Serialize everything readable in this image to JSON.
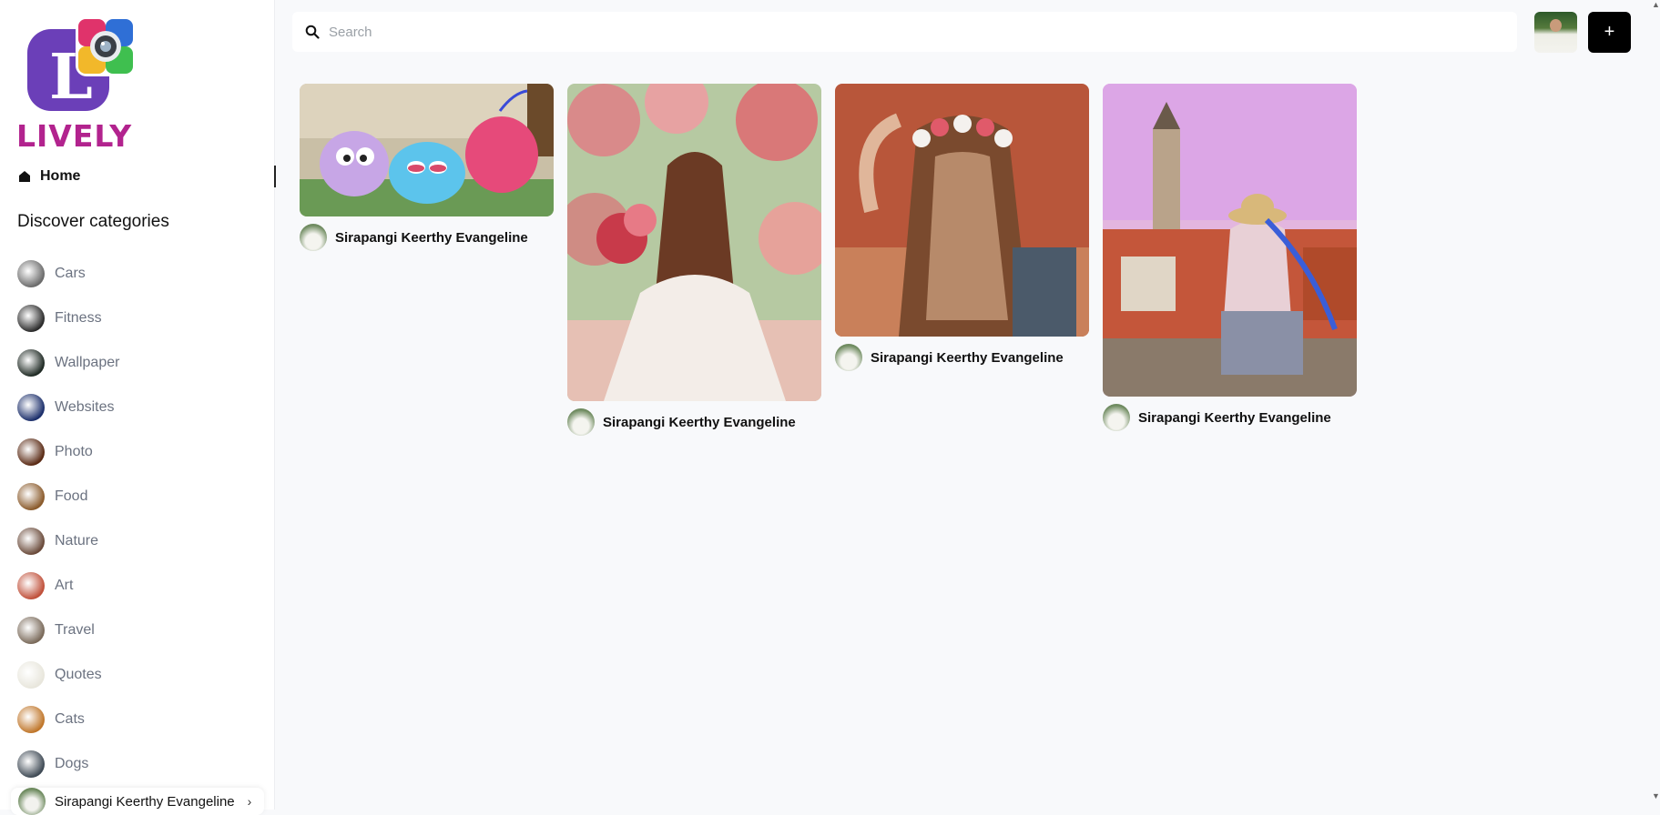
{
  "brand": {
    "name": "LIVELY",
    "initial": "L"
  },
  "nav": {
    "home_label": "Home"
  },
  "sidebar": {
    "discover_title": "Discover categories",
    "categories": [
      {
        "label": "Cars",
        "icon": "cars-thumbnail",
        "color": "#6b6b6b"
      },
      {
        "label": "Fitness",
        "icon": "fitness-thumbnail",
        "color": "#2b2b2b"
      },
      {
        "label": "Wallpaper",
        "icon": "wallpaper-thumbnail",
        "color": "#1f2a24"
      },
      {
        "label": "Websites",
        "icon": "websites-thumbnail",
        "color": "#1c2f6b"
      },
      {
        "label": "Photo",
        "icon": "photo-thumbnail",
        "color": "#5a2a14"
      },
      {
        "label": "Food",
        "icon": "food-thumbnail",
        "color": "#8a5a2b"
      },
      {
        "label": "Nature",
        "icon": "nature-thumbnail",
        "color": "#6a4a3a"
      },
      {
        "label": "Art",
        "icon": "art-thumbnail",
        "color": "#c0503a"
      },
      {
        "label": "Travel",
        "icon": "travel-thumbnail",
        "color": "#7a6a5a"
      },
      {
        "label": "Quotes",
        "icon": "quotes-thumbnail",
        "color": "#e8e6dc"
      },
      {
        "label": "Cats",
        "icon": "cats-thumbnail",
        "color": "#c0762a"
      },
      {
        "label": "Dogs",
        "icon": "dogs-thumbnail",
        "color": "#3f4a55"
      }
    ],
    "profile": {
      "name": "Sirapangi Keerthy Evangeline",
      "chevron": "›"
    }
  },
  "search": {
    "placeholder": "Search",
    "value": ""
  },
  "header": {
    "add_label": "+"
  },
  "pins": [
    {
      "author": "Sirapangi Keerthy Evangeline",
      "image": "cartoon-birds"
    },
    {
      "author": "Sirapangi Keerthy Evangeline",
      "image": "bride-garden"
    },
    {
      "author": "Sirapangi Keerthy Evangeline",
      "image": "flower-crown"
    },
    {
      "author": "Sirapangi Keerthy Evangeline",
      "image": "town-view"
    }
  ],
  "colors": {
    "accent": "#b2238e",
    "background": "#f8f9fb",
    "button": "#000000"
  }
}
